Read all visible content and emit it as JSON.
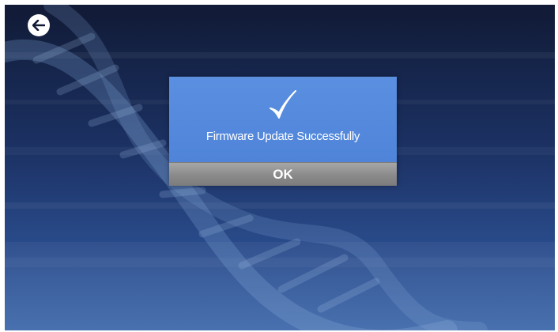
{
  "toolbar": {
    "back_icon": "arrow-left-icon"
  },
  "dialog": {
    "status_icon": "checkmark-icon",
    "message": "Firmware Update Successfully",
    "ok_label": "OK"
  },
  "colors": {
    "dialog_blue": "#5288dc",
    "ok_button_gray": "#8f8f8f",
    "background_dark": "#111a35",
    "background_light": "#3561a6"
  }
}
